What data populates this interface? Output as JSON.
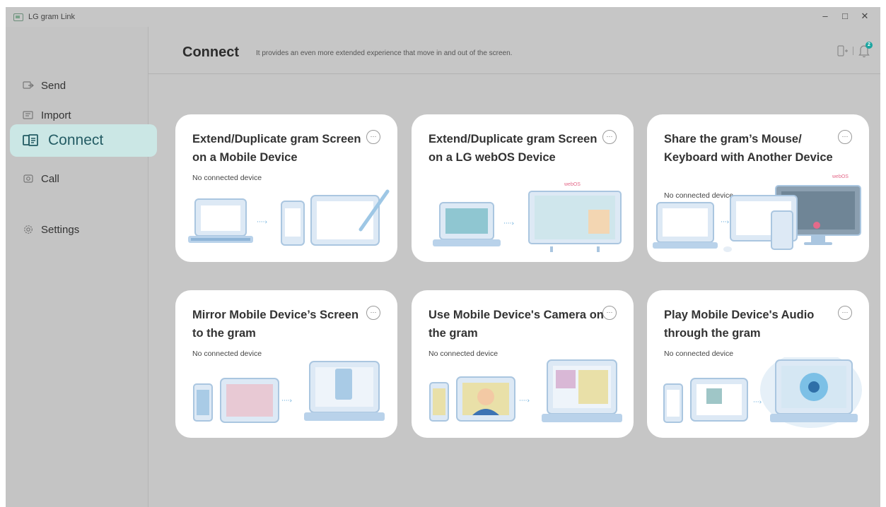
{
  "window": {
    "title": "LG gram Link",
    "controls": [
      "–",
      "□",
      "✕"
    ]
  },
  "sidebar": {
    "items": [
      {
        "label": "Send",
        "icon": "send-icon"
      },
      {
        "label": "Import",
        "icon": "import-icon"
      },
      {
        "label": "Connect",
        "icon": "connect-icon",
        "active": true
      },
      {
        "label": "Call",
        "icon": "call-icon"
      },
      {
        "label": "Settings",
        "icon": "gear-icon"
      }
    ]
  },
  "header": {
    "title": "Connect",
    "description": "It provides an even more extended experience that move in and out of the screen.",
    "notification_count": "2"
  },
  "cards": [
    {
      "title": "Extend/Duplicate gram Screen on a Mobile Device",
      "status": "No connected device"
    },
    {
      "title": "Extend/Duplicate gram Screen on a LG webOS Device",
      "status": ""
    },
    {
      "title": "Share the gram’s Mouse/ Keyboard with Another Device",
      "status": "No connected device",
      "brand_tag": "webOS"
    },
    {
      "title": "Mirror Mobile Device’s Screen to the gram",
      "status": "No connected device"
    },
    {
      "title": "Use Mobile Device's Camera on the gram",
      "status": "No connected device"
    },
    {
      "title": "Play Mobile Device's Audio through the gram",
      "status": "No connected device"
    }
  ],
  "card2_brand_tag": "webOS",
  "more_label": "···",
  "colors": {
    "accent": "#1ba5a0",
    "active_bg": "#cbe7e5",
    "illustration": "#c9dff0"
  }
}
